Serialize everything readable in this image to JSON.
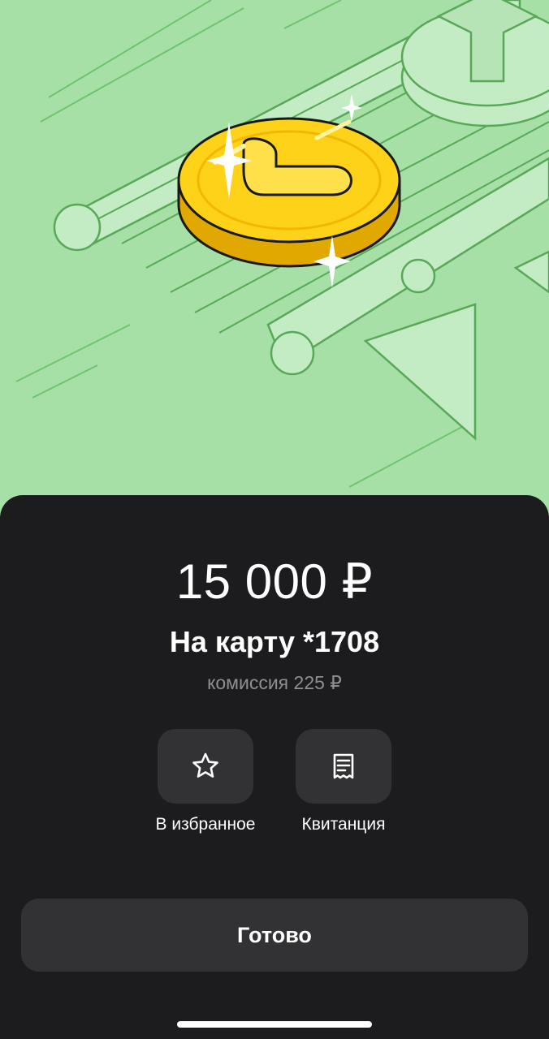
{
  "amount": "15 000 ₽",
  "destination": "На карту *1708",
  "commission": "комиссия 225 ₽",
  "actions": [
    {
      "label": "В избранное",
      "icon": "star-icon"
    },
    {
      "label": "Квитанция",
      "icon": "receipt-icon"
    }
  ],
  "done_label": "Готово",
  "colors": {
    "hero_background": "#a6e0a6",
    "sheet_background": "#1c1c1e",
    "button_background": "#323234",
    "coin": "#ffd21a",
    "secondary_text": "#8e8e93"
  }
}
